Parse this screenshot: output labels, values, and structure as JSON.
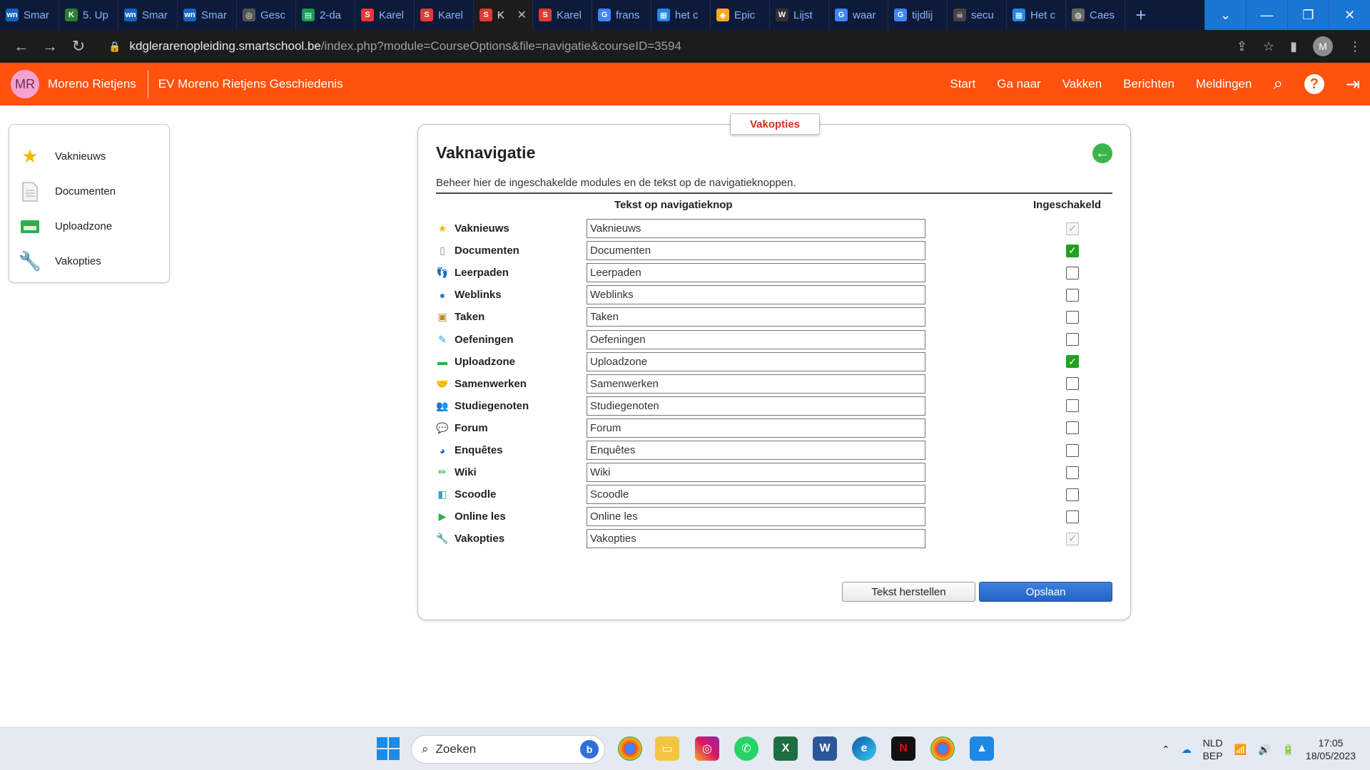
{
  "browser": {
    "tabs": [
      {
        "label": "Smar",
        "fav": "wn",
        "color": "#1565c0"
      },
      {
        "label": "5. Up",
        "fav": "K",
        "color": "#2e7d32"
      },
      {
        "label": "Smar",
        "fav": "wn",
        "color": "#1565c0"
      },
      {
        "label": "Smar",
        "fav": "wn",
        "color": "#1565c0"
      },
      {
        "label": "Gesc",
        "fav": "◎",
        "color": "#555"
      },
      {
        "label": "2-da",
        "fav": "▤",
        "color": "#0f9d58"
      },
      {
        "label": "Karel",
        "fav": "S",
        "color": "#e53935"
      },
      {
        "label": "Karel",
        "fav": "S",
        "color": "#e53935"
      },
      {
        "label": "K",
        "fav": "S",
        "color": "#e53935",
        "active": true
      },
      {
        "label": "Karel",
        "fav": "S",
        "color": "#e53935"
      },
      {
        "label": "frans",
        "fav": "G",
        "color": "#4285f4"
      },
      {
        "label": "het c",
        "fav": "▦",
        "color": "#1e88e5"
      },
      {
        "label": "Epic",
        "fav": "◆",
        "color": "#f9a825"
      },
      {
        "label": "Lijst",
        "fav": "W",
        "color": "#333"
      },
      {
        "label": "waar",
        "fav": "G",
        "color": "#4285f4"
      },
      {
        "label": "tijdlij",
        "fav": "G",
        "color": "#4285f4"
      },
      {
        "label": "secu",
        "fav": "☠",
        "color": "#444"
      },
      {
        "label": "Het c",
        "fav": "▦",
        "color": "#1e88e5"
      },
      {
        "label": "Caes",
        "fav": "◍",
        "color": "#666"
      }
    ],
    "url_host": "kdglerarenopleiding.smartschool.be",
    "url_path": "/index.php?module=CourseOptions&file=navigatie&courseID=3594",
    "profile_initial": "M"
  },
  "header": {
    "avatar_initials": "MR",
    "user_name": "Moreno Rietjens",
    "course_name": "EV Moreno Rietjens Geschiedenis",
    "nav": [
      "Start",
      "Ga naar",
      "Vakken",
      "Berichten",
      "Meldingen"
    ]
  },
  "sidebar": {
    "items": [
      {
        "label": "Vaknieuws",
        "icon": "star-icon"
      },
      {
        "label": "Documenten",
        "icon": "document-icon"
      },
      {
        "label": "Uploadzone",
        "icon": "upload-tray-icon"
      },
      {
        "label": "Vakopties",
        "icon": "wrench-icon"
      }
    ]
  },
  "panel": {
    "tab_label": "Vakopties",
    "title": "Vaknavigatie",
    "description": "Beheer hier de ingeschakelde modules en de tekst op de navigatieknoppen.",
    "col_text": "Tekst op navigatieknop",
    "col_enabled": "Ingeschakeld",
    "rows": [
      {
        "label": "Vaknieuws",
        "value": "Vaknieuws",
        "checked": true,
        "disabled": true,
        "icon": "star-icon",
        "glyph": "★",
        "color": "#f5b800"
      },
      {
        "label": "Documenten",
        "value": "Documenten",
        "checked": true,
        "disabled": false,
        "icon": "document-icon",
        "glyph": "▯",
        "color": "#888"
      },
      {
        "label": "Leerpaden",
        "value": "Leerpaden",
        "checked": false,
        "disabled": false,
        "icon": "footprints-icon",
        "glyph": "👣",
        "color": "#f5b800"
      },
      {
        "label": "Weblinks",
        "value": "Weblinks",
        "checked": false,
        "disabled": false,
        "icon": "globe-icon",
        "glyph": "●",
        "color": "#2e7dd1"
      },
      {
        "label": "Taken",
        "value": "Taken",
        "checked": false,
        "disabled": false,
        "icon": "briefcase-icon",
        "glyph": "▣",
        "color": "#c28a2e"
      },
      {
        "label": "Oefeningen",
        "value": "Oefeningen",
        "checked": false,
        "disabled": false,
        "icon": "exercise-icon",
        "glyph": "✎",
        "color": "#3a9ad9"
      },
      {
        "label": "Uploadzone",
        "value": "Uploadzone",
        "checked": true,
        "disabled": false,
        "icon": "upload-tray-icon",
        "glyph": "▬",
        "color": "#2fae4a"
      },
      {
        "label": "Samenwerken",
        "value": "Samenwerken",
        "checked": false,
        "disabled": false,
        "icon": "handshake-icon",
        "glyph": "🤝",
        "color": "#e0782b"
      },
      {
        "label": "Studiegenoten",
        "value": "Studiegenoten",
        "checked": false,
        "disabled": false,
        "icon": "people-icon",
        "glyph": "👥",
        "color": "#e08a2b"
      },
      {
        "label": "Forum",
        "value": "Forum",
        "checked": false,
        "disabled": false,
        "icon": "speech-bubble-icon",
        "glyph": "💬",
        "color": "#7a86c9"
      },
      {
        "label": "Enquêtes",
        "value": "Enquêtes",
        "checked": false,
        "disabled": false,
        "icon": "pie-chart-icon",
        "glyph": "◕",
        "color": "#1e6fd6"
      },
      {
        "label": "Wiki",
        "value": "Wiki",
        "checked": false,
        "disabled": false,
        "icon": "pencil-icon",
        "glyph": "✏",
        "color": "#2fae4a"
      },
      {
        "label": "Scoodle",
        "value": "Scoodle",
        "checked": false,
        "disabled": false,
        "icon": "scoodle-icon",
        "glyph": "◧",
        "color": "#3aa0c8"
      },
      {
        "label": "Online les",
        "value": "Online les",
        "checked": false,
        "disabled": false,
        "icon": "play-icon",
        "glyph": "▶",
        "color": "#2fae4a"
      },
      {
        "label": "Vakopties",
        "value": "Vakopties",
        "checked": true,
        "disabled": true,
        "icon": "wrench-icon",
        "glyph": "🔧",
        "color": "#666"
      }
    ],
    "btn_reset": "Tekst herstellen",
    "btn_save": "Opslaan"
  },
  "taskbar": {
    "search_placeholder": "Zoeken",
    "lang_line1": "NLD",
    "lang_line2": "BEP",
    "time": "17:05",
    "date": "18/05/2023"
  }
}
